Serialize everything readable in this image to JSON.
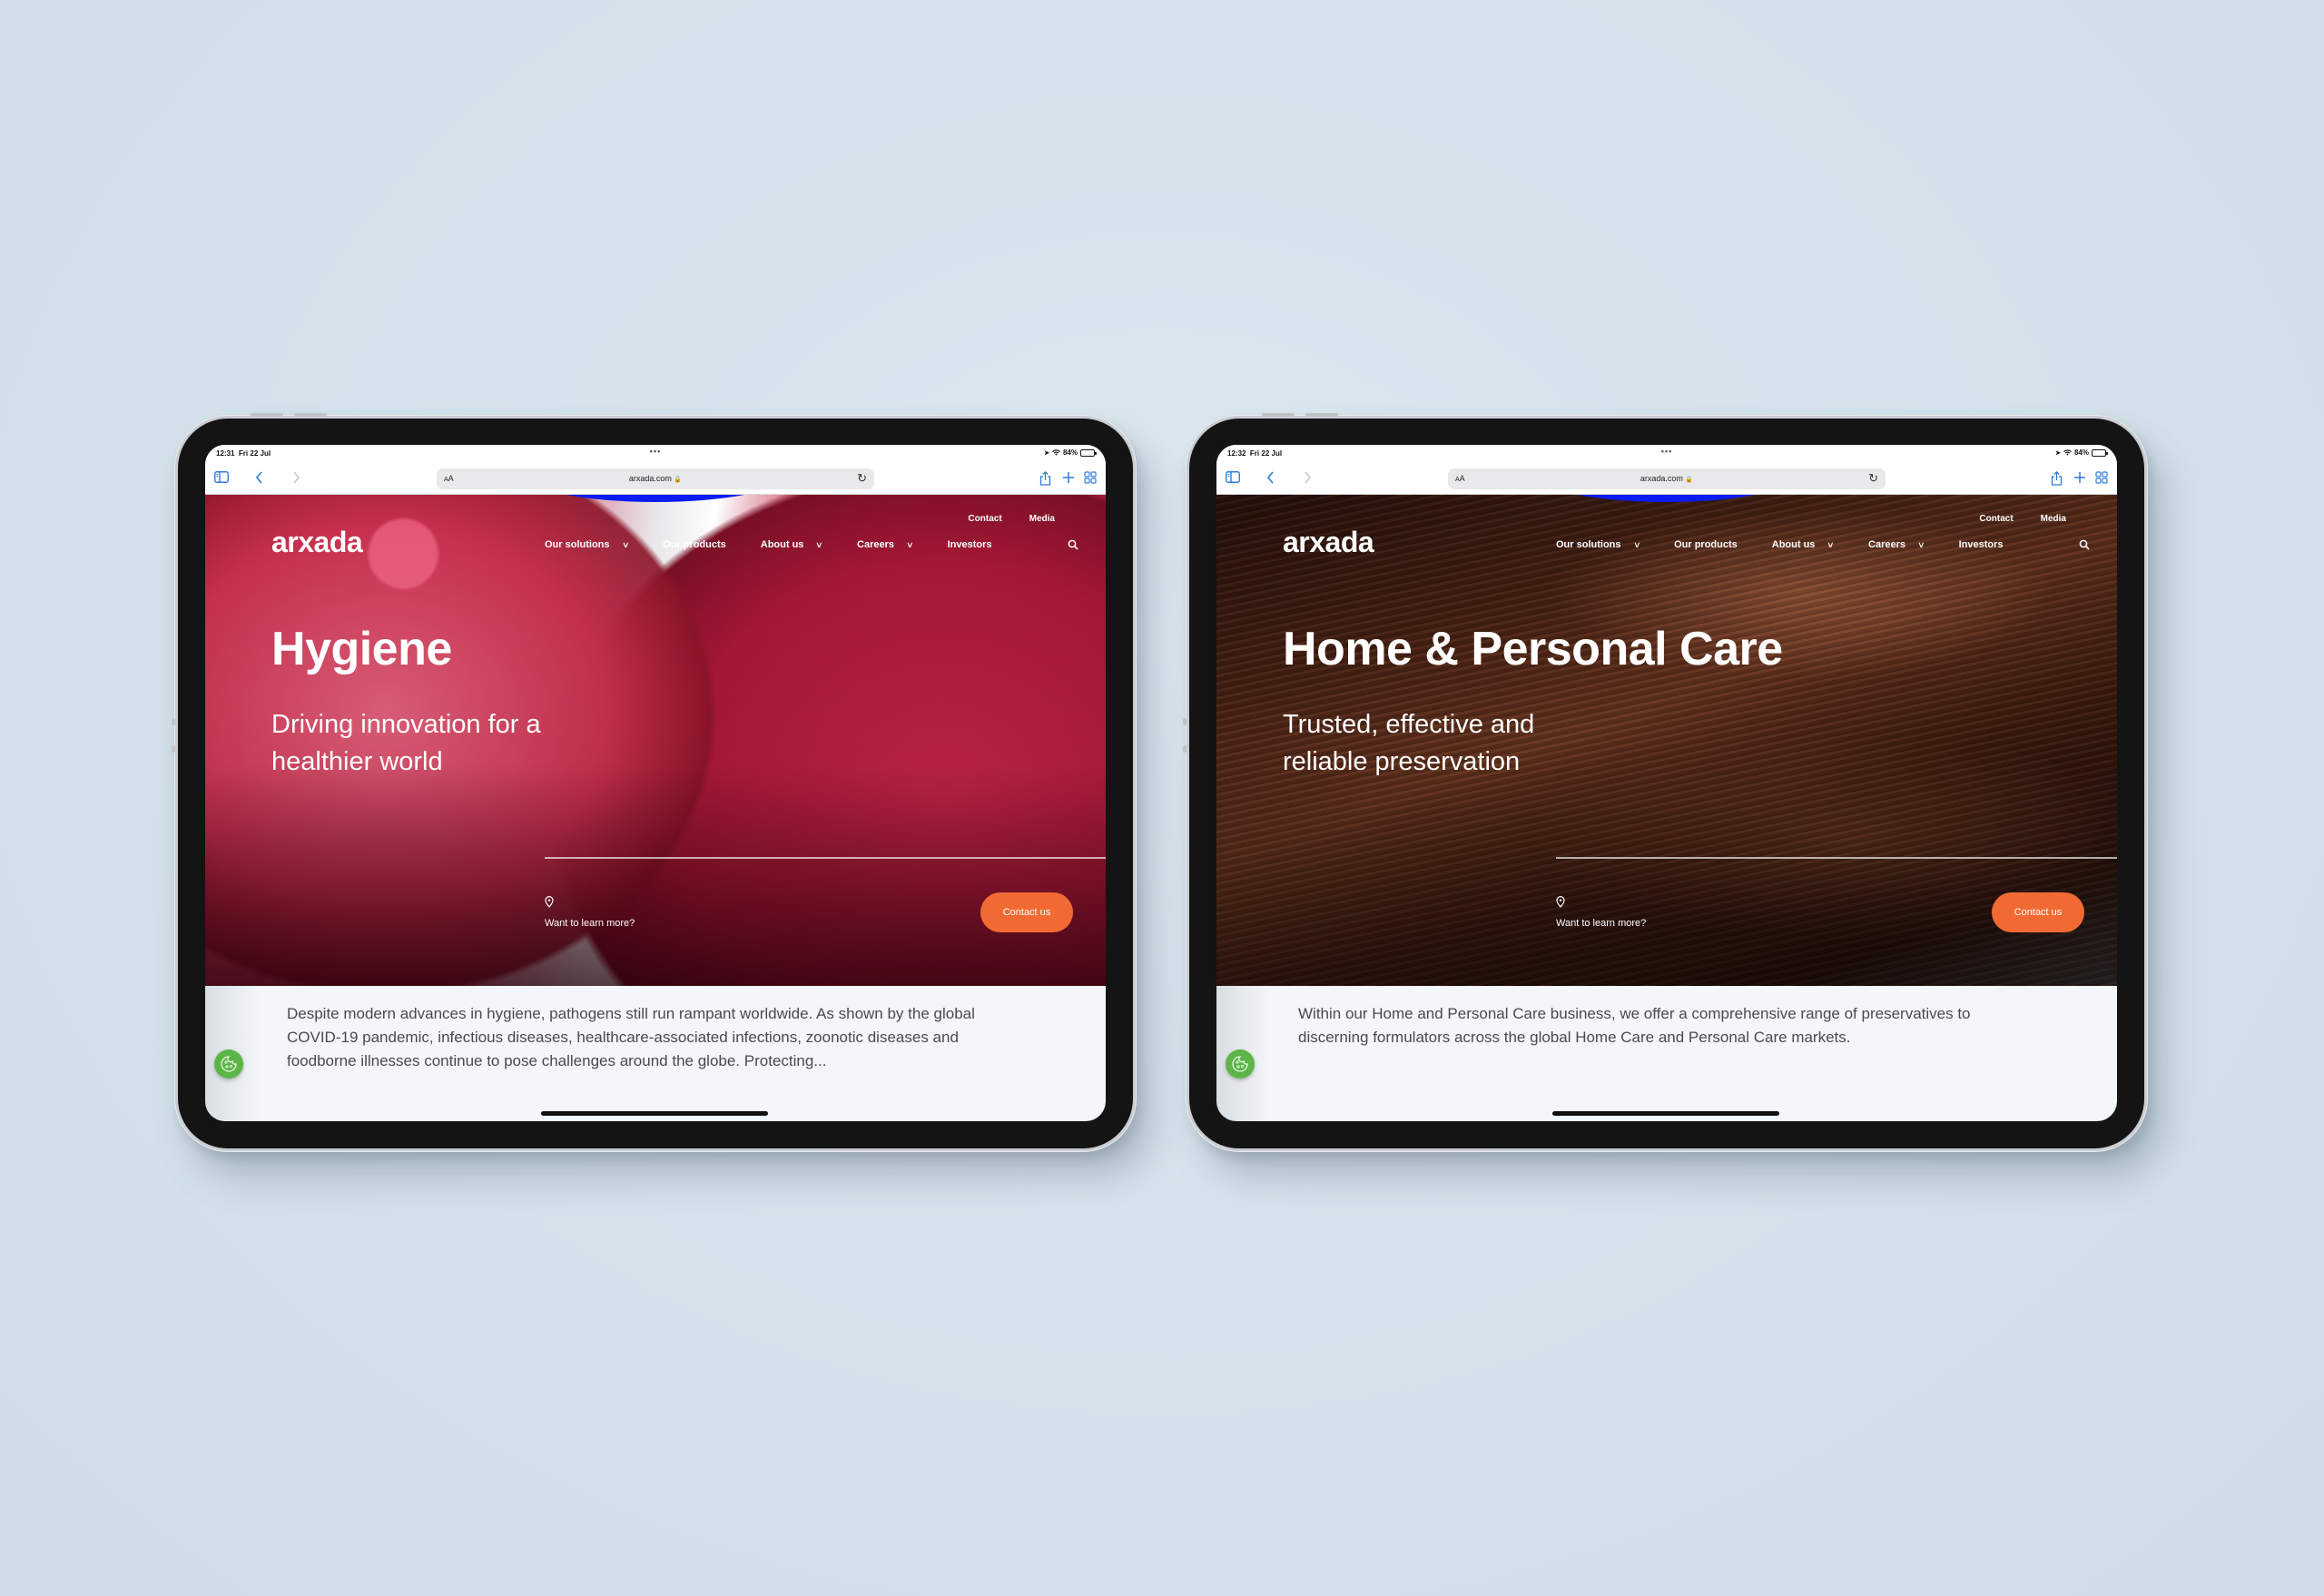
{
  "background_color": "#d5e3ec",
  "devices": [
    {
      "status_bar": {
        "time": "12:31",
        "date": "Fri 22 Jul",
        "battery": "84%",
        "battery_level": 0.84,
        "multitask_dots": "•••"
      },
      "safari": {
        "text_size_label": "AA",
        "url": "arxada.com",
        "lock_icon": "lock-icon",
        "icons": [
          "sidebar-icon",
          "back-icon",
          "forward-icon",
          "reload-icon",
          "share-icon",
          "new-tab-icon",
          "tabs-overview-icon"
        ]
      },
      "site": {
        "logo": "arxada",
        "top_nav": [
          "Contact",
          "Media"
        ],
        "main_nav": [
          {
            "label": "Our solutions",
            "has_dropdown": true
          },
          {
            "label": "Our products",
            "has_dropdown": false
          },
          {
            "label": "About us",
            "has_dropdown": true
          },
          {
            "label": "Careers",
            "has_dropdown": true
          },
          {
            "label": "Investors",
            "has_dropdown": false
          }
        ],
        "hero_title": "Hygiene",
        "hero_subtitle": "Driving innovation for a healthier world",
        "learn_more": "Want to learn more?",
        "contact_button": "Contact us",
        "body_text": "Despite modern advances in hygiene, pathogens still run rampant worldwide. As shown by the global COVID-19 pandemic, infectious diseases, healthcare-associated infections, zoonotic diseases and foodborne illnesses continue to pose challenges around the globe. Protecting...",
        "hero_image": "pink petri dishes with bacterial colonies"
      }
    },
    {
      "status_bar": {
        "time": "12:32",
        "date": "Fri 22 Jul",
        "battery": "84%",
        "battery_level": 0.84,
        "multitask_dots": "•••"
      },
      "safari": {
        "text_size_label": "AA",
        "url": "arxada.com",
        "lock_icon": "lock-icon",
        "icons": [
          "sidebar-icon",
          "back-icon",
          "forward-icon",
          "reload-icon",
          "share-icon",
          "new-tab-icon",
          "tabs-overview-icon"
        ]
      },
      "site": {
        "logo": "arxada",
        "top_nav": [
          "Contact",
          "Media"
        ],
        "main_nav": [
          {
            "label": "Our solutions",
            "has_dropdown": true
          },
          {
            "label": "Our products",
            "has_dropdown": false
          },
          {
            "label": "About us",
            "has_dropdown": true
          },
          {
            "label": "Careers",
            "has_dropdown": true
          },
          {
            "label": "Investors",
            "has_dropdown": false
          }
        ],
        "hero_title": "Home & Personal Care",
        "hero_subtitle": "Trusted, effective and reliable preservation",
        "learn_more": "Want to learn more?",
        "contact_button": "Contact us",
        "body_text": "Within our Home and Personal Care business, we offer a comprehensive range of preservatives to discerning formulators across the global Home Care and Personal Care markets.",
        "hero_image": "flowing brown hair"
      }
    }
  ],
  "colors": {
    "accent_orange": "#f26a33",
    "safari_blue": "#2f7bd9",
    "cookie_green": "#5cb548",
    "content_bg": "#f3f7fa"
  }
}
